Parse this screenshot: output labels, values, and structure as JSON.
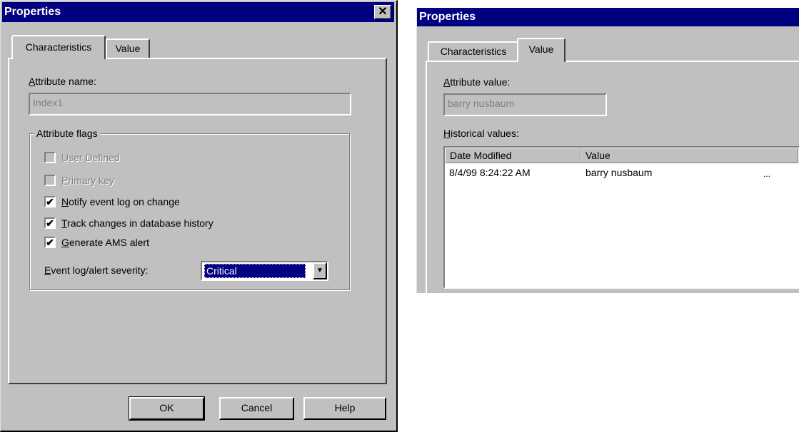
{
  "left_dialog": {
    "title": "Properties",
    "close_glyph": "✕",
    "tabs": [
      {
        "label": "Characteristics",
        "active": true
      },
      {
        "label": "Value",
        "active": false
      }
    ],
    "attribute_name": {
      "label_accel": "A",
      "label_rest": "ttribute name:",
      "value": "Index1"
    },
    "flags_group": {
      "label": "Attribute flags",
      "items": [
        {
          "accel": "U",
          "rest": "ser Defined",
          "checked": false,
          "enabled": false
        },
        {
          "accel": "P",
          "rest": "rimary key",
          "checked": false,
          "enabled": false
        },
        {
          "accel": "N",
          "rest": "otify event log on change",
          "checked": true,
          "enabled": true
        },
        {
          "accel": "T",
          "rest": "rack changes in database history",
          "checked": true,
          "enabled": true
        },
        {
          "accel": "G",
          "rest": "enerate AMS alert",
          "checked": true,
          "enabled": true
        }
      ],
      "severity": {
        "label_accel": "E",
        "label_rest": "vent log/alert severity:",
        "value": "Critical",
        "arrow": "▼"
      }
    },
    "buttons": {
      "ok": "OK",
      "cancel": "Cancel",
      "help": "Help"
    },
    "check_glyph": "✔"
  },
  "right_dialog": {
    "title": "Properties",
    "tabs": [
      {
        "label": "Characteristics",
        "active": false
      },
      {
        "label": "Value",
        "active": true
      }
    ],
    "attribute_value": {
      "label_accel": "A",
      "label_rest": "ttribute value:",
      "value": "barry nusbaum"
    },
    "historical": {
      "label_accel": "H",
      "label_rest": "istorical values:",
      "columns": [
        "Date Modified",
        "Value"
      ],
      "rows": [
        {
          "date": "8/4/99 8:24:22 AM",
          "value": "barry nusbaum",
          "more": "..."
        }
      ]
    }
  }
}
